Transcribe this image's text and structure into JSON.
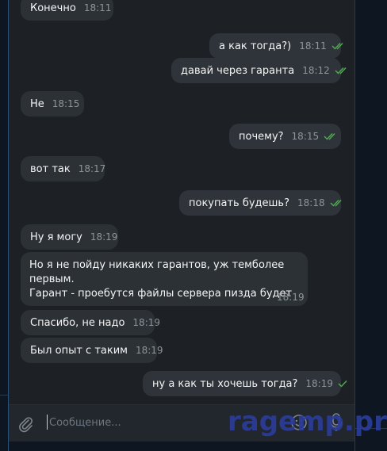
{
  "messages": [
    {
      "text": "Конечно",
      "time": "18:11",
      "dir": "in"
    },
    {
      "text": "а как тогда?)",
      "time": "18:11",
      "dir": "out",
      "status": "read"
    },
    {
      "text": "давай через гаранта",
      "time": "18:12",
      "dir": "out",
      "status": "read"
    },
    {
      "text": "Не",
      "time": "18:15",
      "dir": "in"
    },
    {
      "text": "почему?",
      "time": "18:15",
      "dir": "out",
      "status": "read"
    },
    {
      "text": "вот так",
      "time": "18:17",
      "dir": "in"
    },
    {
      "text": "покупать будешь?",
      "time": "18:18",
      "dir": "out",
      "status": "read"
    },
    {
      "text": "Ну я могу",
      "time": "18:19",
      "dir": "in"
    },
    {
      "lines": [
        "Но я не пойду никаких гарантов, уж темболее",
        "первым.",
        "Гарант - проебутся файлы сервера пизда будет"
      ],
      "time": "18:19",
      "dir": "in"
    },
    {
      "text": "Спасибо, не надо",
      "time": "18:19",
      "dir": "in"
    },
    {
      "text": "Был опыт с таким",
      "time": "18:19",
      "dir": "in"
    },
    {
      "text": "ну а как ты хочешь тогда?",
      "time": "18:19",
      "dir": "out",
      "status": "sent"
    }
  ],
  "composer": {
    "placeholder": "Сообщение..."
  },
  "watermark": "ragemp.pro",
  "icons": {
    "attach": "paperclip-icon",
    "emoji": "smile-icon",
    "mic": "microphone-icon",
    "read": "double-check-icon",
    "sent": "single-check-icon"
  },
  "colors": {
    "background": "#1d2126",
    "bubble_in": "#2c3136",
    "bubble_out": "#2e3439",
    "check": "#4fae4e",
    "watermark": "#2b3c9a"
  }
}
